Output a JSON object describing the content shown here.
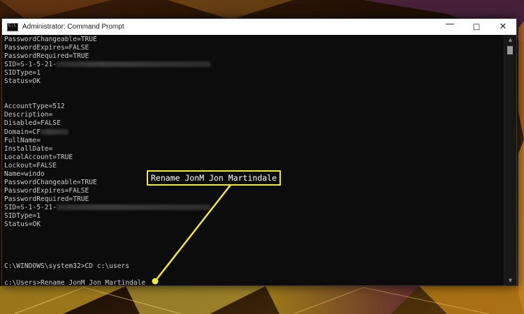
{
  "window": {
    "title": "Administrator: Command Prompt",
    "controls": {
      "minimize": "—",
      "maximize": "☐",
      "close": "✕"
    }
  },
  "console": {
    "lines": [
      {
        "text": "PasswordChangeable=TRUE"
      },
      {
        "text": "PasswordExpires=FALSE"
      },
      {
        "text": "PasswordRequired=TRUE"
      },
      {
        "text": "SID=S-1-5-21-",
        "redacted": true
      },
      {
        "text": "SIDType=1"
      },
      {
        "text": "Status=OK"
      },
      {
        "text": ""
      },
      {
        "text": ""
      },
      {
        "text": "AccountType=512"
      },
      {
        "text": "Description="
      },
      {
        "text": "Disabled=FALSE"
      },
      {
        "text": "Domain=CF",
        "redacted": true
      },
      {
        "text": "FullName="
      },
      {
        "text": "InstallDate="
      },
      {
        "text": "LocalAccount=TRUE"
      },
      {
        "text": "Lockout=FALSE"
      },
      {
        "text": "Name=windo"
      },
      {
        "text": "PasswordChangeable=TRUE"
      },
      {
        "text": "PasswordExpires=FALSE"
      },
      {
        "text": "PasswordRequired=TRUE"
      },
      {
        "text": "SID=S-1-5-21-",
        "redacted": true
      },
      {
        "text": "SIDType=1"
      },
      {
        "text": "Status=OK"
      },
      {
        "text": ""
      },
      {
        "text": ""
      },
      {
        "text": ""
      },
      {
        "text": ""
      },
      {
        "text": "C:\\WINDOWS\\system32>CD c:\\users"
      },
      {
        "text": ""
      },
      {
        "text": "c:\\Users>Rename JonM Jon Martindale"
      }
    ]
  },
  "callout": {
    "text": "Rename JonM Jon Martindale",
    "color": "#f2ea3a"
  },
  "colors": {
    "console_bg": "#0c0c0c",
    "console_text": "#cccccc",
    "titlebar_bg": "#ffffff"
  }
}
